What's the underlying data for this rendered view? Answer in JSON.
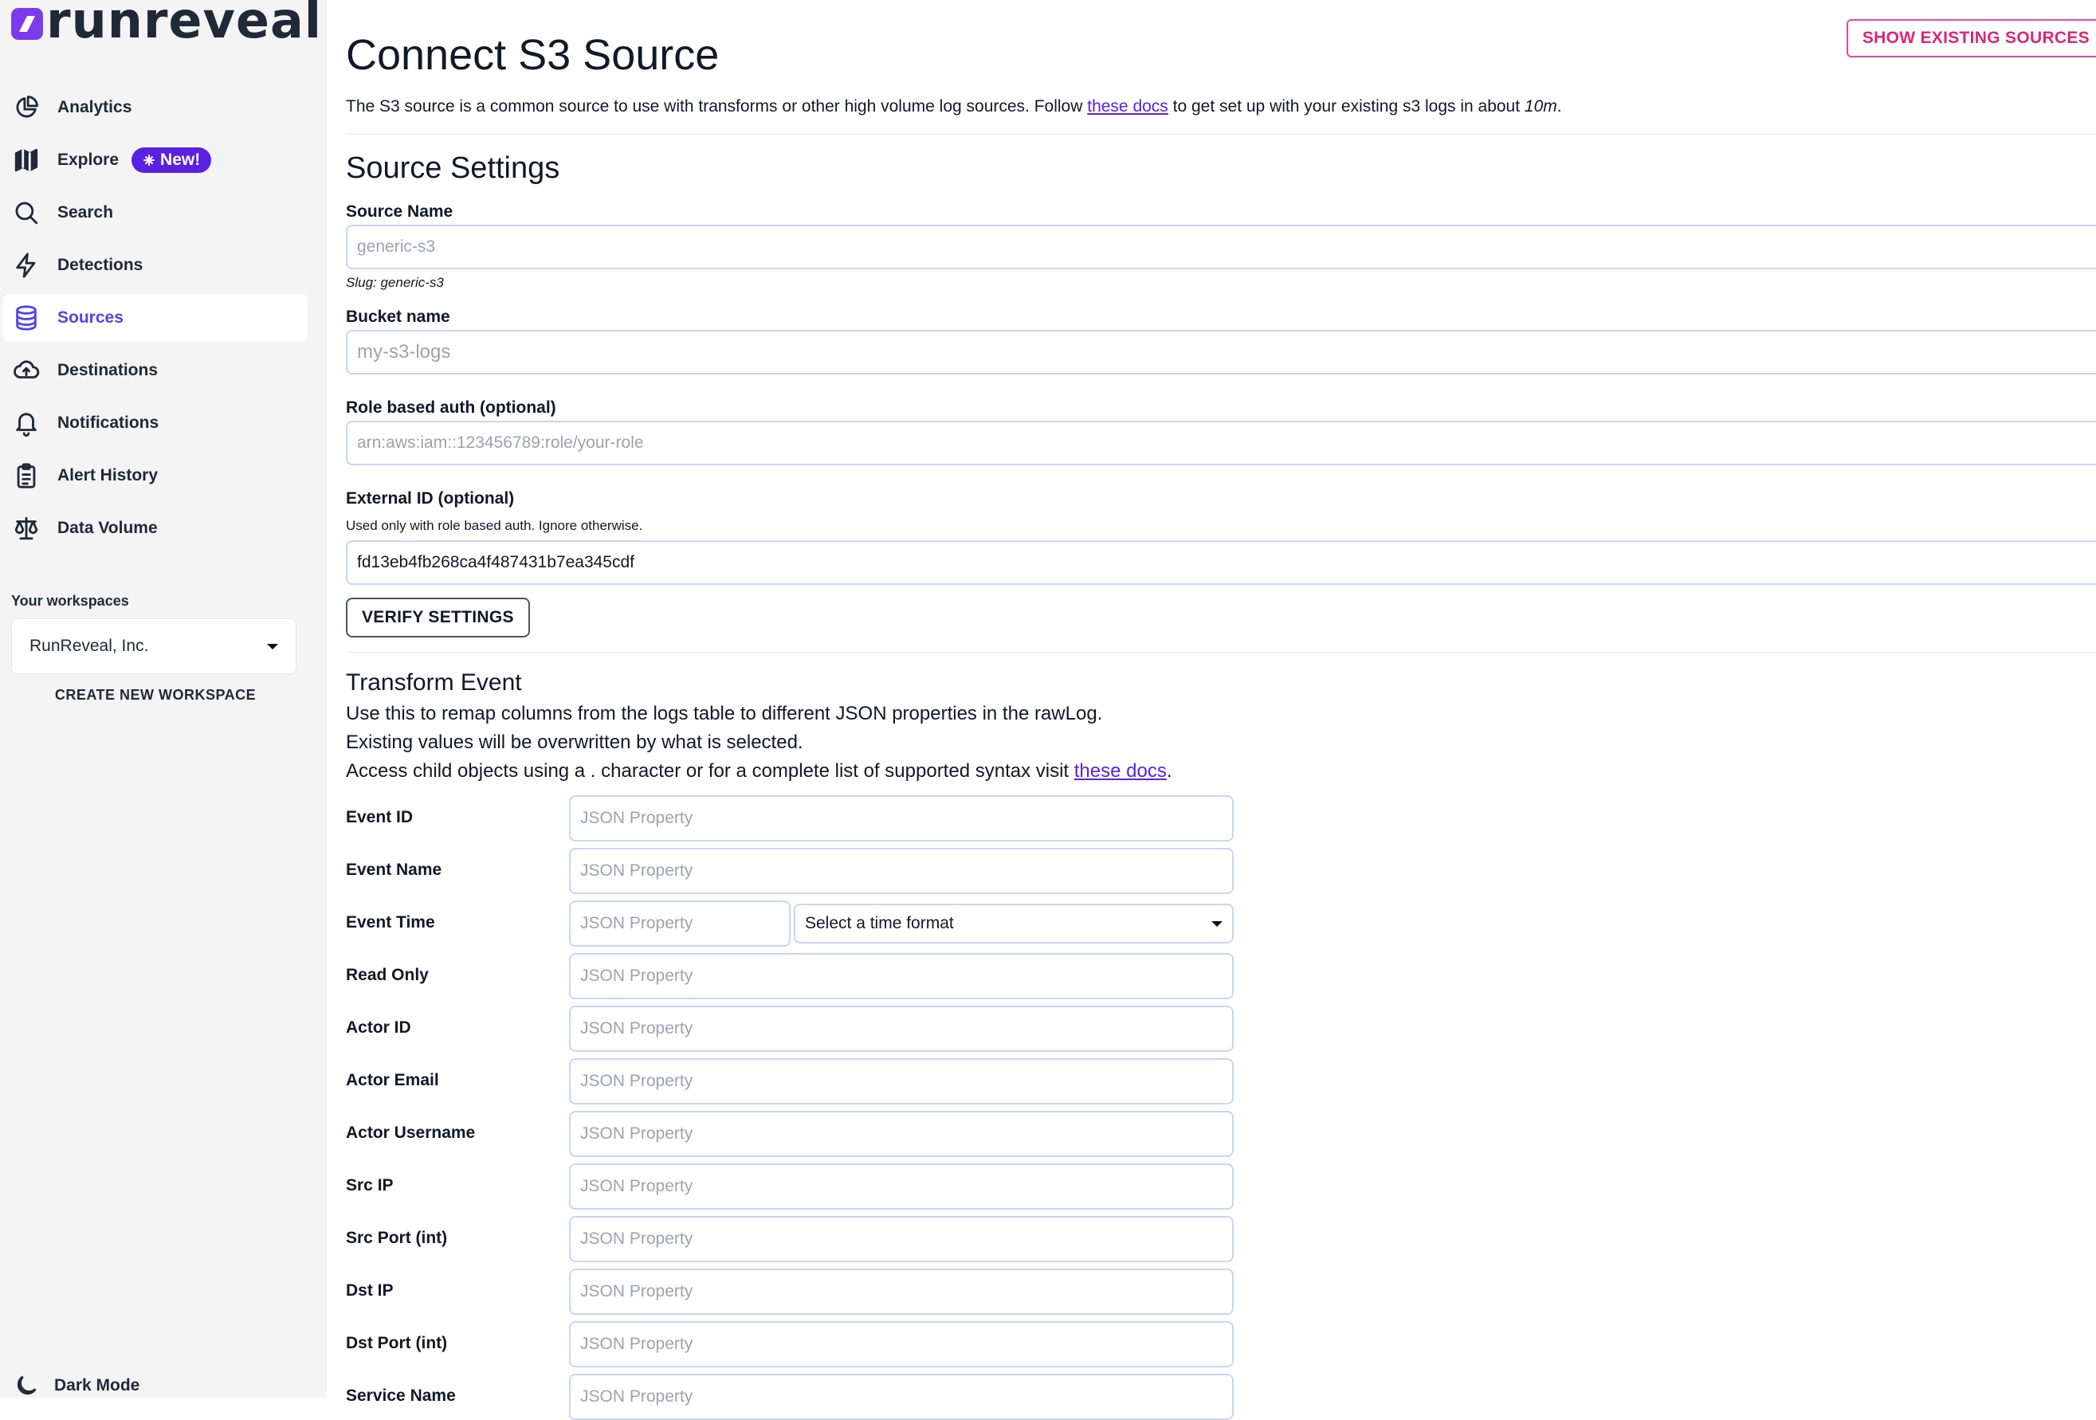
{
  "app": {
    "name": "runreveal"
  },
  "sidebar": {
    "items": [
      {
        "label": "Analytics",
        "icon": "chart-pie-icon"
      },
      {
        "label": "Explore",
        "icon": "map-icon",
        "badge": "New!"
      },
      {
        "label": "Search",
        "icon": "search-icon"
      },
      {
        "label": "Detections",
        "icon": "bolt-icon"
      },
      {
        "label": "Sources",
        "icon": "database-icon",
        "active": true
      },
      {
        "label": "Destinations",
        "icon": "cloud-upload-icon"
      },
      {
        "label": "Notifications",
        "icon": "bell-icon"
      },
      {
        "label": "Alert History",
        "icon": "clipboard-icon"
      },
      {
        "label": "Data Volume",
        "icon": "scale-icon"
      }
    ],
    "workspaces_label": "Your workspaces",
    "workspace_selected": "RunReveal, Inc.",
    "create_workspace": "CREATE NEW WORKSPACE",
    "dark_mode": "Dark Mode"
  },
  "header": {
    "show_existing": "SHOW EXISTING SOURCES",
    "title": "Connect S3 Source",
    "intro_before": "The S3 source is a common source to use with transforms or other high volume log sources. Follow ",
    "intro_link": "these docs",
    "intro_after": " to get set up with your existing s3 logs in about ",
    "intro_time": "10m",
    "intro_end": "."
  },
  "settings": {
    "title": "Source Settings",
    "source_name_label": "Source Name",
    "source_name_placeholder": "generic-s3",
    "slug": "Slug: generic-s3",
    "bucket_label": "Bucket name",
    "bucket_placeholder": "my-s3-logs",
    "role_label": "Role based auth (optional)",
    "role_placeholder": "arn:aws:iam::123456789:role/your-role",
    "external_label": "External ID (optional)",
    "external_hint": "Used only with role based auth. Ignore otherwise.",
    "external_value": "fd13eb4fb268ca4f487431b7ea345cdf",
    "verify": "VERIFY SETTINGS"
  },
  "transform": {
    "title": "Transform Event",
    "line1": "Use this to remap columns from the logs table to different JSON properties in the rawLog.",
    "line2": "Existing values will be overwritten by what is selected.",
    "line3_before": "Access child objects using a . character or for a complete list of supported syntax visit ",
    "line3_link": "these docs",
    "line3_end": ".",
    "placeholder": "JSON Property",
    "time_format": "Select a time format",
    "fields": [
      "Event ID",
      "Event Name",
      "Event Time",
      "Read Only",
      "Actor ID",
      "Actor Email",
      "Actor Username",
      "Src IP",
      "Src Port (int)",
      "Dst IP",
      "Dst Port (int)",
      "Service Name"
    ]
  },
  "colors": {
    "accent": "#5b21e0",
    "active": "#4f46e5",
    "pink": "#db2777",
    "input_border": "#c7d7f2"
  }
}
